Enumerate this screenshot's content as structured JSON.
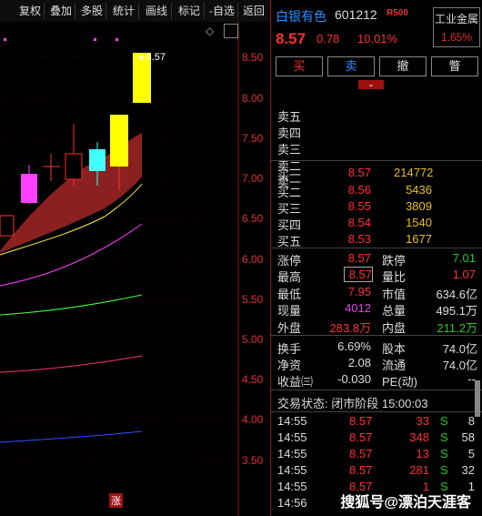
{
  "toolbar": {
    "items": [
      "复权",
      "叠加",
      "多股",
      "统计",
      "画线",
      "标记",
      "-自选",
      "返回"
    ]
  },
  "chart": {
    "y_ticks": [
      "8.50",
      "8.00",
      "7.50",
      "7.00",
      "6.50",
      "6.00",
      "5.50",
      "5.00",
      "4.50",
      "4.00",
      "3.50"
    ],
    "last_price_label": "8.57",
    "zhang_label": "涨",
    "diamond_icon": "diamond-icon",
    "colors": {
      "up": "#ffff00",
      "cyan": "#40ffff",
      "magenta": "#ff40ff",
      "ma_yellow": "#e8e040",
      "band": "#8b2020"
    }
  },
  "header": {
    "name": "白银有色",
    "code": "601212",
    "r_badge": "R500",
    "industry_name": "工业金属",
    "industry_pct": "1.65%",
    "price": "8.57",
    "change": "0.78",
    "change_pct": "10.01%"
  },
  "trade_buttons": [
    "买",
    "卖",
    "撤",
    "瞥"
  ],
  "sell_levels": [
    "卖五",
    "卖四",
    "卖三",
    "卖二",
    "卖一"
  ],
  "buy_levels": [
    {
      "label": "买一",
      "price": "8.57",
      "vol": "214772"
    },
    {
      "label": "买二",
      "price": "8.56",
      "vol": "5436"
    },
    {
      "label": "买三",
      "price": "8.55",
      "vol": "3809"
    },
    {
      "label": "买四",
      "price": "8.54",
      "vol": "1540"
    },
    {
      "label": "买五",
      "price": "8.53",
      "vol": "1677"
    }
  ],
  "stats": {
    "zhangting_label": "涨停",
    "zhangting": "8.57",
    "dieting_label": "跌停",
    "dieting": "7.01",
    "high_label": "最高",
    "high": "8.57",
    "liangbi_label": "量比",
    "liangbi": "1.07",
    "low_label": "最低",
    "low": "7.95",
    "shizhi_label": "市值",
    "shizhi": "634.6亿",
    "xianliang_label": "现量",
    "xianliang": "4012",
    "zongliang_label": "总量",
    "zongliang": "495.1万",
    "waipan_label": "外盘",
    "waipan": "283.8万",
    "neipan_label": "内盘",
    "neipan": "211.2万"
  },
  "fund": {
    "huanshou_label": "换手",
    "huanshou": "6.69%",
    "guben_label": "股本",
    "guben": "74.0亿",
    "jingzi_label": "净资",
    "jingzi": "2.08",
    "liutong_label": "流通",
    "liutong": "74.0亿",
    "shouyi_label": "收益㈢",
    "shouyi": "-0.030",
    "pe_label": "PE(动)",
    "pe": "--"
  },
  "status": {
    "text": "交易状态: 闭市阶段 15:00:03"
  },
  "ticks": [
    {
      "time": "14:55",
      "price": "8.57",
      "vol": "33",
      "side": "S",
      "n": "8"
    },
    {
      "time": "14:55",
      "price": "8.57",
      "vol": "348",
      "side": "S",
      "n": "58"
    },
    {
      "time": "14:55",
      "price": "8.57",
      "vol": "13",
      "side": "S",
      "n": "5"
    },
    {
      "time": "14:55",
      "price": "8.57",
      "vol": "281",
      "side": "S",
      "n": "32"
    },
    {
      "time": "14:55",
      "price": "8.57",
      "vol": "1",
      "side": "S",
      "n": "1"
    },
    {
      "time": "14:56",
      "price": "",
      "vol": "",
      "side": "",
      "n": ""
    },
    {
      "time": "14:56",
      "price": "",
      "vol": "",
      "side": "",
      "n": ""
    }
  ],
  "watermark": "搜狐号@漂泊天涯客"
}
